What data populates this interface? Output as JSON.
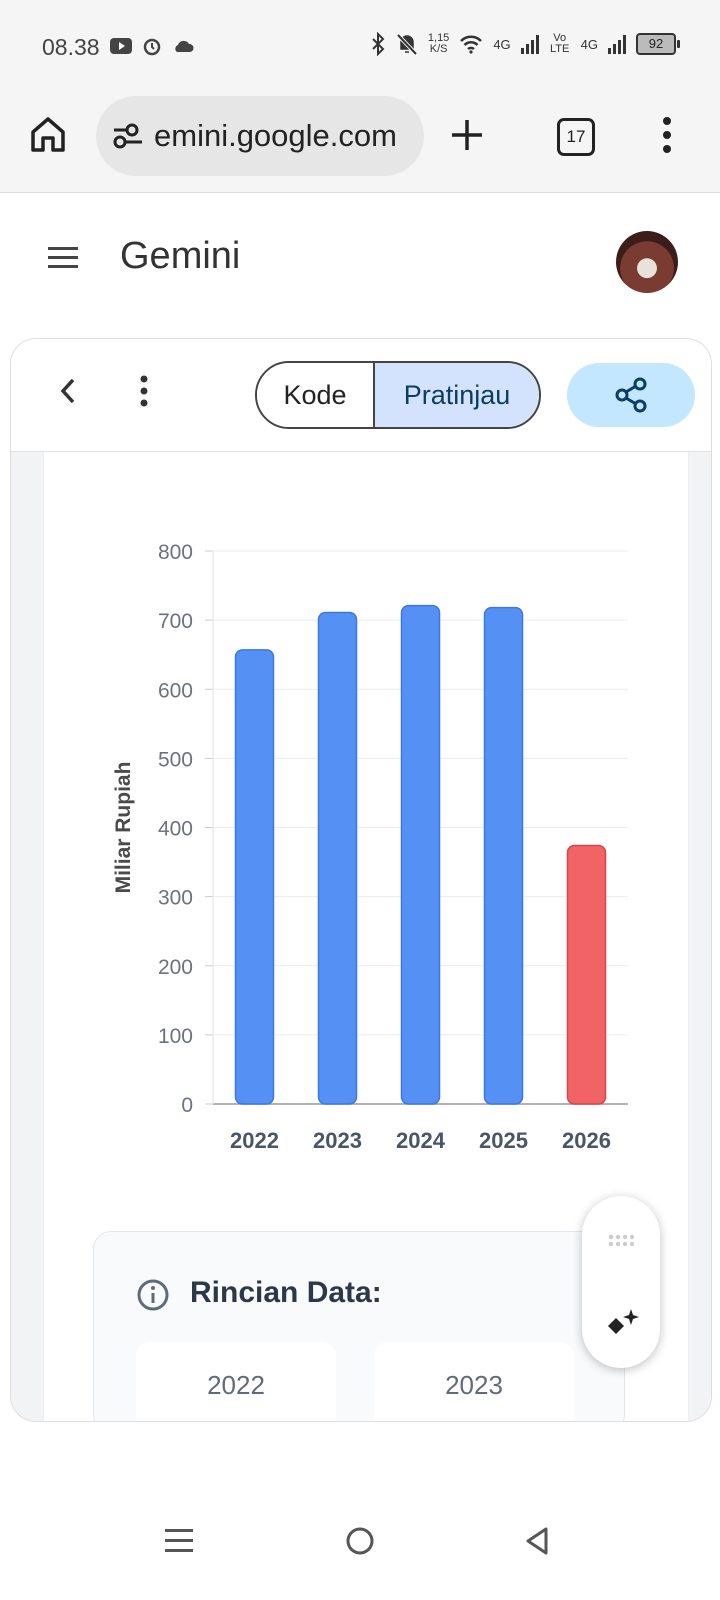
{
  "status_bar": {
    "time": "08.38",
    "speed_value": "1,15",
    "speed_unit": "K/S",
    "net1": "4G",
    "volte": "Vo LTE",
    "net2": "4G",
    "battery": "92"
  },
  "browser": {
    "url": "emini.google.com",
    "tab_count": "17"
  },
  "app": {
    "title": "Gemini"
  },
  "canvas": {
    "tab_code": "Kode",
    "tab_preview": "Pratinjau"
  },
  "chart_data": {
    "type": "bar",
    "categories": [
      "2022",
      "2023",
      "2024",
      "2025",
      "2026"
    ],
    "values": [
      657,
      711,
      721,
      718,
      374
    ],
    "colors": [
      "#5591f5",
      "#5591f5",
      "#5591f5",
      "#5591f5",
      "#f06466"
    ],
    "ylabel": "Miliar Rupiah",
    "ylim": [
      0,
      800
    ],
    "yticks": [
      "0",
      "100",
      "200",
      "300",
      "400",
      "500",
      "600",
      "700",
      "800"
    ],
    "grid": true
  },
  "details": {
    "title": "Rincian Data:",
    "cards": [
      "2022",
      "2023"
    ]
  },
  "colors": {
    "accent": "#0b57d0",
    "bar": "#5591f5",
    "bar_highlight": "#f06466"
  }
}
